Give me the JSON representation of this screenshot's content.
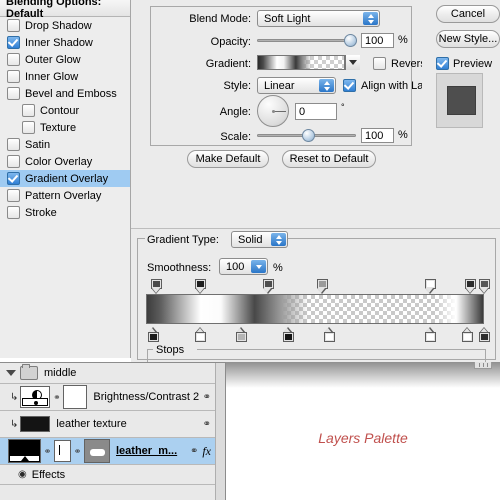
{
  "dialog": {
    "styles_header": "Blending Options: Default",
    "effects": [
      {
        "label": "Drop Shadow",
        "checked": false,
        "indent": false,
        "selected": false
      },
      {
        "label": "Inner Shadow",
        "checked": true,
        "indent": false,
        "selected": false
      },
      {
        "label": "Outer Glow",
        "checked": false,
        "indent": false,
        "selected": false
      },
      {
        "label": "Inner Glow",
        "checked": false,
        "indent": false,
        "selected": false
      },
      {
        "label": "Bevel and Emboss",
        "checked": false,
        "indent": false,
        "selected": false
      },
      {
        "label": "Contour",
        "checked": false,
        "indent": true,
        "selected": false
      },
      {
        "label": "Texture",
        "checked": false,
        "indent": true,
        "selected": false
      },
      {
        "label": "Satin",
        "checked": false,
        "indent": false,
        "selected": false
      },
      {
        "label": "Color Overlay",
        "checked": false,
        "indent": false,
        "selected": false
      },
      {
        "label": "Gradient Overlay",
        "checked": true,
        "indent": false,
        "selected": true
      },
      {
        "label": "Pattern Overlay",
        "checked": false,
        "indent": false,
        "selected": false
      },
      {
        "label": "Stroke",
        "checked": false,
        "indent": false,
        "selected": false
      }
    ]
  },
  "gradient_overlay": {
    "blend_mode_label": "Blend Mode:",
    "blend_mode_value": "Soft Light",
    "opacity_label": "Opacity:",
    "opacity_value": "100",
    "opacity_unit": "%",
    "opacity_percent": 93,
    "gradient_label": "Gradient:",
    "reverse_label": "Reverse",
    "reverse_checked": false,
    "style_label": "Style:",
    "style_value": "Linear",
    "align_label": "Align with Layer",
    "align_checked": true,
    "angle_label": "Angle:",
    "angle_value": "0",
    "angle_unit": "°",
    "angle_degrees": 0,
    "scale_label": "Scale:",
    "scale_value": "100",
    "scale_unit": "%",
    "scale_percent": 50,
    "make_default": "Make Default",
    "reset_to_default": "Reset to Default"
  },
  "buttons": {
    "cancel": "Cancel",
    "new_style": "New Style...",
    "preview_label": "Preview",
    "preview_checked": true
  },
  "gradient_editor": {
    "type_label": "Gradient Type:",
    "type_value": "Solid",
    "smoothness_label": "Smoothness:",
    "smoothness_value": "100",
    "smoothness_unit": "%",
    "stops_legend": "Stops",
    "opacity_stops": [
      {
        "position": 3,
        "fill": "#4a4a4a"
      },
      {
        "position": 16,
        "fill": "#1d1d1d"
      },
      {
        "position": 36,
        "fill": "#4e4e4e"
      },
      {
        "position": 52,
        "fill": "#9b9b9b"
      },
      {
        "position": 84,
        "fill": "#ffffff"
      },
      {
        "position": 96,
        "fill": "#2b2b2b"
      },
      {
        "position": 100,
        "fill": "#555555"
      }
    ],
    "color_stops": [
      {
        "position": 2,
        "fill": "#1b1b1b"
      },
      {
        "position": 16,
        "fill": "#ffffff"
      },
      {
        "position": 28,
        "fill": "#b4b4b4"
      },
      {
        "position": 42,
        "fill": "#151515"
      },
      {
        "position": 54,
        "fill": "#ffffff"
      },
      {
        "position": 84,
        "fill": "#ffffff"
      },
      {
        "position": 95,
        "fill": "#ffffff"
      },
      {
        "position": 100,
        "fill": "#2e2e2e"
      }
    ]
  },
  "layers_palette": {
    "rows": [
      {
        "kind": "group",
        "name": "middle",
        "expanded": true
      },
      {
        "kind": "layer",
        "name": "Brightness/Contrast 2",
        "selected": false,
        "thumb": "adjustment-brightness-contrast",
        "has_mask": true,
        "linked": true,
        "mask_link": true,
        "fx": false,
        "clipped": true
      },
      {
        "kind": "layer",
        "name": "leather texture",
        "selected": false,
        "thumb": "dark-swatch",
        "has_mask": false,
        "linked": false,
        "mask_link": true,
        "fx": false,
        "clipped": true
      },
      {
        "kind": "layer",
        "name": "leather_m...",
        "selected": true,
        "thumb": "black-gradient",
        "has_mask": true,
        "linked": true,
        "mask_link": true,
        "fx": true,
        "clipped": false
      },
      {
        "kind": "effects",
        "name": "Effects"
      }
    ]
  },
  "canvas": {
    "annotation": "Layers Palette"
  }
}
